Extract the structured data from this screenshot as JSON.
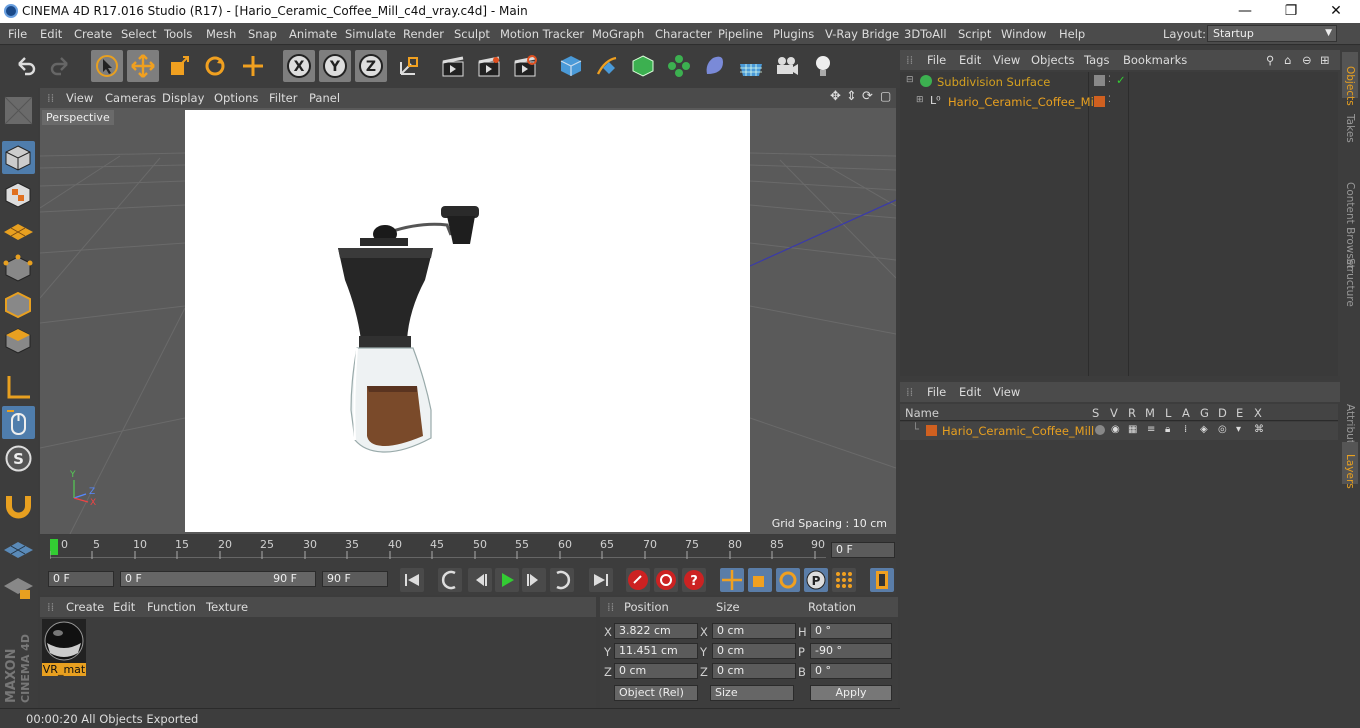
{
  "window": {
    "title": "CINEMA 4D R17.016 Studio (R17) - [Hario_Ceramic_Coffee_Mill_c4d_vray.c4d] - Main",
    "minimize": "—",
    "maximize": "❐",
    "close": "✕"
  },
  "menu": {
    "items": [
      "File",
      "Edit",
      "Create",
      "Select",
      "Tools",
      "Mesh",
      "Snap",
      "Animate",
      "Simulate",
      "Render",
      "Sculpt",
      "Motion Tracker",
      "MoGraph",
      "Character",
      "Pipeline",
      "Plugins",
      "V-Ray Bridge",
      "3DToAll",
      "Script",
      "Window",
      "Help"
    ],
    "layout_label": "Layout:",
    "layout_value": "Startup"
  },
  "viewport": {
    "menu": [
      "View",
      "Cameras",
      "Display",
      "Options",
      "Filter",
      "Panel"
    ],
    "camera_label": "Perspective",
    "grid_spacing": "Grid Spacing : 10 cm",
    "axis": {
      "y": "Y",
      "z": "Z",
      "x": "X"
    }
  },
  "timeline": {
    "ticks": [
      "0",
      "5",
      "10",
      "15",
      "20",
      "25",
      "30",
      "35",
      "40",
      "45",
      "50",
      "55",
      "60",
      "65",
      "70",
      "75",
      "80",
      "85",
      "90"
    ],
    "current_frame": "0 F",
    "start_field": "0 F",
    "range_start": "0 F",
    "range_end": "90 F",
    "end_field": "90 F",
    "end_field2": "90 F"
  },
  "material_panel": {
    "menu": [
      "Create",
      "Edit",
      "Function",
      "Texture"
    ],
    "material_name": "VR_mat"
  },
  "coords": {
    "headers": [
      "Position",
      "Size",
      "Rotation"
    ],
    "rows": [
      {
        "axis": "X",
        "pos": "3.822 cm",
        "saxis": "X",
        "size": "0 cm",
        "raxis": "H",
        "rot": "0 °"
      },
      {
        "axis": "Y",
        "pos": "11.451 cm",
        "saxis": "Y",
        "size": "0 cm",
        "raxis": "P",
        "rot": "-90 °"
      },
      {
        "axis": "Z",
        "pos": "0 cm",
        "saxis": "Z",
        "size": "0 cm",
        "raxis": "B",
        "rot": "0 °"
      }
    ],
    "mode_select": "Object (Rel)",
    "size_select": "Size",
    "apply": "Apply"
  },
  "status": {
    "text": "00:00:20 All Objects Exported"
  },
  "object_manager": {
    "menu": [
      "File",
      "Edit",
      "View",
      "Objects",
      "Tags",
      "Bookmarks"
    ],
    "objects": [
      {
        "name": "Subdivision Surface",
        "color": "#d4a020"
      },
      {
        "name": "Hario_Ceramic_Coffee_Mill",
        "color": "#e8a020"
      }
    ]
  },
  "layer_manager": {
    "menu": [
      "File",
      "Edit",
      "View"
    ],
    "columns": [
      "Name",
      "S",
      "V",
      "R",
      "M",
      "L",
      "A",
      "G",
      "D",
      "E",
      "X"
    ],
    "layers": [
      {
        "name": "Hario_Ceramic_Coffee_Mill",
        "color": "#d06020"
      }
    ]
  },
  "right_tabs": [
    "Objects",
    "Takes",
    "Content Browser",
    "Structure",
    "Attributes",
    "Layers"
  ],
  "branding": {
    "maxon": "MAXON",
    "c4d": "CINEMA 4D"
  }
}
